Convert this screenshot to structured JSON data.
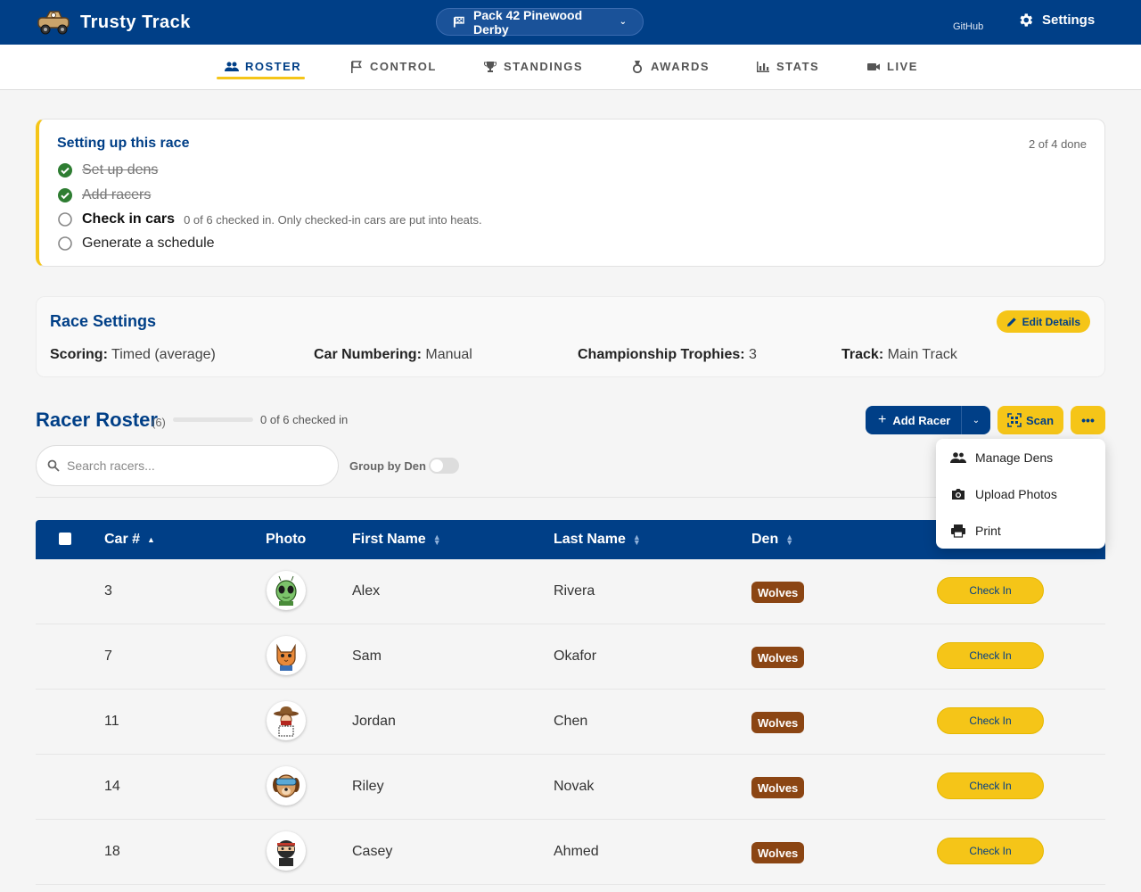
{
  "app": {
    "name": "Trusty Track",
    "event_name": "Pack 42 Pinewood Derby",
    "github_label": "GitHub",
    "settings_label": "Settings"
  },
  "tabs": [
    {
      "label": "ROSTER",
      "active": true,
      "icon": "people-icon"
    },
    {
      "label": "CONTROL",
      "active": false,
      "icon": "flag-icon"
    },
    {
      "label": "STANDINGS",
      "active": false,
      "icon": "trophy-icon"
    },
    {
      "label": "AWARDS",
      "active": false,
      "icon": "medal-icon"
    },
    {
      "label": "STATS",
      "active": false,
      "icon": "bar-chart-icon"
    },
    {
      "label": "LIVE",
      "active": false,
      "icon": "video-camera-icon"
    }
  ],
  "setup": {
    "title": "Setting up this race",
    "progress": "2 of 4 done",
    "steps": [
      {
        "label": "Set up dens",
        "status": "done"
      },
      {
        "label": "Add racers",
        "status": "done"
      },
      {
        "label": "Check in cars",
        "status": "current",
        "hint": "0 of 6 checked in. Only checked-in cars are put into heats."
      },
      {
        "label": "Generate a schedule",
        "status": "pending"
      }
    ]
  },
  "race_settings": {
    "title": "Race Settings",
    "edit_label": "Edit Details",
    "scoring_label": "Scoring:",
    "scoring_value": "Timed (average)",
    "numbering_label": "Car Numbering:",
    "numbering_value": "Manual",
    "trophies_label": "Championship Trophies:",
    "trophies_value": "3",
    "track_label": "Track:",
    "track_value": "Main Track"
  },
  "roster": {
    "title": "Racer Roster",
    "count": "(6)",
    "checked_in_fraction": 0,
    "checked_in_text": "0 of 6 checked in",
    "add_racer_label": "Add Racer",
    "scan_label": "Scan",
    "search_placeholder": "Search racers...",
    "group_by_label": "Group by Den",
    "group_by_enabled": false
  },
  "more_menu": {
    "items": [
      {
        "label": "Manage Dens",
        "icon": "people-icon"
      },
      {
        "label": "Upload Photos",
        "icon": "camera-icon"
      },
      {
        "label": "Print",
        "icon": "printer-icon"
      }
    ]
  },
  "table": {
    "columns": {
      "car": "Car #",
      "photo": "Photo",
      "first": "First Name",
      "last": "Last Name",
      "den": "Den"
    },
    "sort": {
      "column": "car",
      "direction": "asc"
    },
    "rows": [
      {
        "car": "3",
        "first": "Alex",
        "last": "Rivera",
        "den": "Wolves",
        "action": "Check In",
        "avatar": "alien-avatar-icon"
      },
      {
        "car": "7",
        "first": "Sam",
        "last": "Okafor",
        "den": "Wolves",
        "action": "Check In",
        "avatar": "cat-avatar-icon"
      },
      {
        "car": "11",
        "first": "Jordan",
        "last": "Chen",
        "den": "Wolves",
        "action": "Check In",
        "avatar": "cowboy-avatar-icon"
      },
      {
        "car": "14",
        "first": "Riley",
        "last": "Novak",
        "den": "Wolves",
        "action": "Check In",
        "avatar": "dog-goggles-avatar-icon"
      },
      {
        "car": "18",
        "first": "Casey",
        "last": "Ahmed",
        "den": "Wolves",
        "action": "Check In",
        "avatar": "ninja-avatar-icon"
      }
    ]
  },
  "colors": {
    "primary": "#003f87",
    "accent": "#f5c518",
    "den_badge": "#8b4513",
    "done_check": "#2e7d32"
  }
}
